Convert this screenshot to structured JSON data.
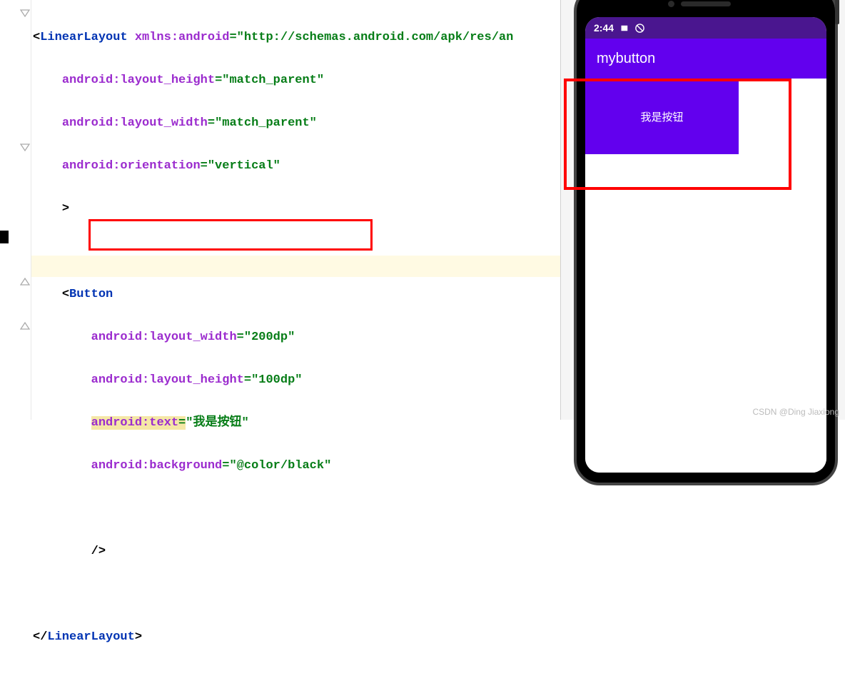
{
  "code": {
    "linearLayout_open": "LinearLayout",
    "xmlns_attr": "xmlns:android",
    "xmlns_val": "\"http://schemas.android.com/apk/res/an",
    "lh_attr": "android:layout_height",
    "lh_val": "\"match_parent\"",
    "lw_attr": "android:layout_width",
    "lw_val": "\"match_parent\"",
    "orient_attr": "android:orientation",
    "orient_val": "\"vertical\"",
    "gt": ">",
    "button_tag": "Button",
    "blw_attr": "android:layout_width",
    "blw_val": "\"200dp\"",
    "blh_attr": "android:layout_height",
    "blh_val": "\"100dp\"",
    "btxt_attr": "android:text",
    "btxt_val": "\"我是按钮\"",
    "bbg_attr": "android:background",
    "bbg_val": "\"@color/black\"",
    "selfclose": "/>",
    "linearLayout_close": "LinearLayout"
  },
  "phone": {
    "status_time": "2:44",
    "app_title": "mybutton",
    "button_text": "我是按钮"
  },
  "watermark": "CSDN @Ding Jiaxiong"
}
